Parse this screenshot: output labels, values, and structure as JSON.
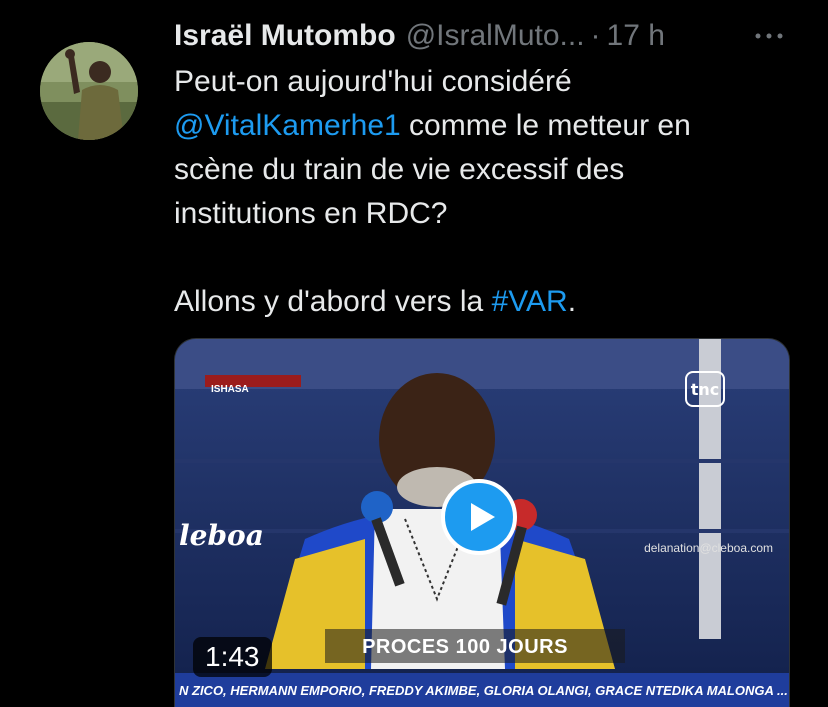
{
  "tweet": {
    "author_name": "Israël Mutombo",
    "handle": "@IsralMuto...",
    "separator": "·",
    "time": "17 h",
    "text_line1_pre": "Peut-on aujourd'hui considéré",
    "mention": "@VitalKamerhe1",
    "text_line2_post": " comme le metteur en",
    "text_line3": "scène du train de vie excessif des",
    "text_line4": "institutions en RDC?",
    "text_line5_pre": "Allons y d'abord vers la ",
    "hashtag": "#VAR",
    "text_line5_post": "."
  },
  "video": {
    "duration": "1:43",
    "overlay_title": "PROCES 100 JOURS",
    "ticker": "N ZICO, HERMANN EMPORIO, FREDDY AKIMBE, GLORIA OLANGI, GRACE NTEDIKA MALONGA ... NC",
    "watermark_logo": "leboa",
    "watermark_url": "delanation@cleboa.com",
    "location_tag": "ISHASA",
    "channel_logo": "tnc"
  },
  "colors": {
    "background": "#000000",
    "text": "#e7e9ea",
    "secondary": "#71767b",
    "link": "#1d9bf0"
  },
  "icons": {
    "more": "more-horizontal-icon",
    "play": "play-icon"
  }
}
